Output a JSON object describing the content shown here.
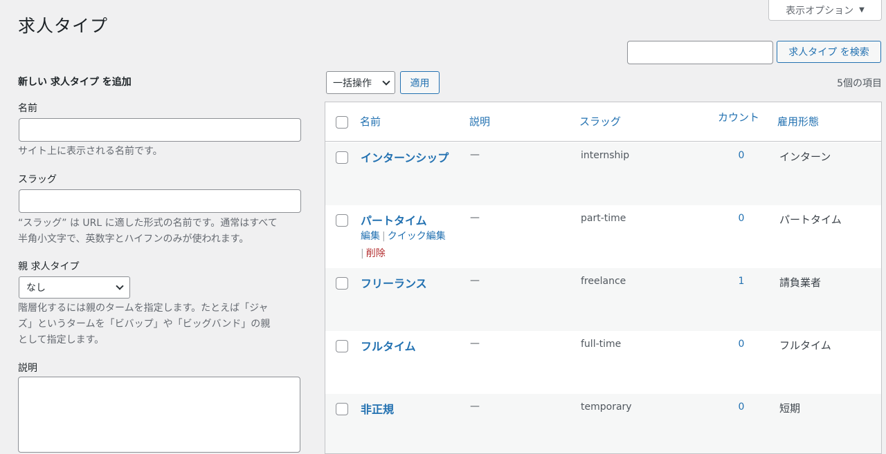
{
  "page": {
    "title": "求人タイプ"
  },
  "screen_options": {
    "label": "表示オプション",
    "arrow": "▼"
  },
  "search": {
    "input_value": "",
    "button_label": "求人タイプ を検索"
  },
  "form": {
    "heading": "新しい 求人タイプ を追加",
    "name_label": "名前",
    "name_value": "",
    "name_desc": "サイト上に表示される名前です。",
    "slug_label": "スラッグ",
    "slug_value": "",
    "slug_desc_1": "“スラッグ” は URL に適した形式の名前です。通常はすべて",
    "slug_desc_2": "半角小文字で、英数字とハイフンのみが使われます。",
    "parent_label": "親 求人タイプ",
    "parent_selected": "なし",
    "parent_desc_1": "階層化するには親のタームを指定します。たとえば「ジャ",
    "parent_desc_2": "ズ」というタームを「ビバップ」や「ビッグバンド」の親",
    "parent_desc_3": "として指定します。",
    "description_label": "説明",
    "description_value": ""
  },
  "bulk": {
    "selected": "一括操作",
    "apply_label": "適用"
  },
  "items_count": "5個の項目",
  "table": {
    "headers": {
      "name": "名前",
      "description": "説明",
      "slug": "スラッグ",
      "count": "カウント",
      "employment": "雇用形態"
    },
    "rows": [
      {
        "name": "インターンシップ",
        "description": "—",
        "slug": "internship",
        "count": "0",
        "employment": "インターン"
      },
      {
        "name": "パートタイム",
        "description": "—",
        "slug": "part-time",
        "count": "0",
        "employment": "パートタイム"
      },
      {
        "name": "フリーランス",
        "description": "—",
        "slug": "freelance",
        "count": "1",
        "employment": "請負業者"
      },
      {
        "name": "フルタイム",
        "description": "—",
        "slug": "full-time",
        "count": "0",
        "employment": "フルタイム"
      },
      {
        "name": "非正規",
        "description": "—",
        "slug": "temporary",
        "count": "0",
        "employment": "短期"
      }
    ],
    "row_actions": {
      "edit": "編集",
      "quick_edit": "クイック編集",
      "delete": "削除"
    }
  }
}
